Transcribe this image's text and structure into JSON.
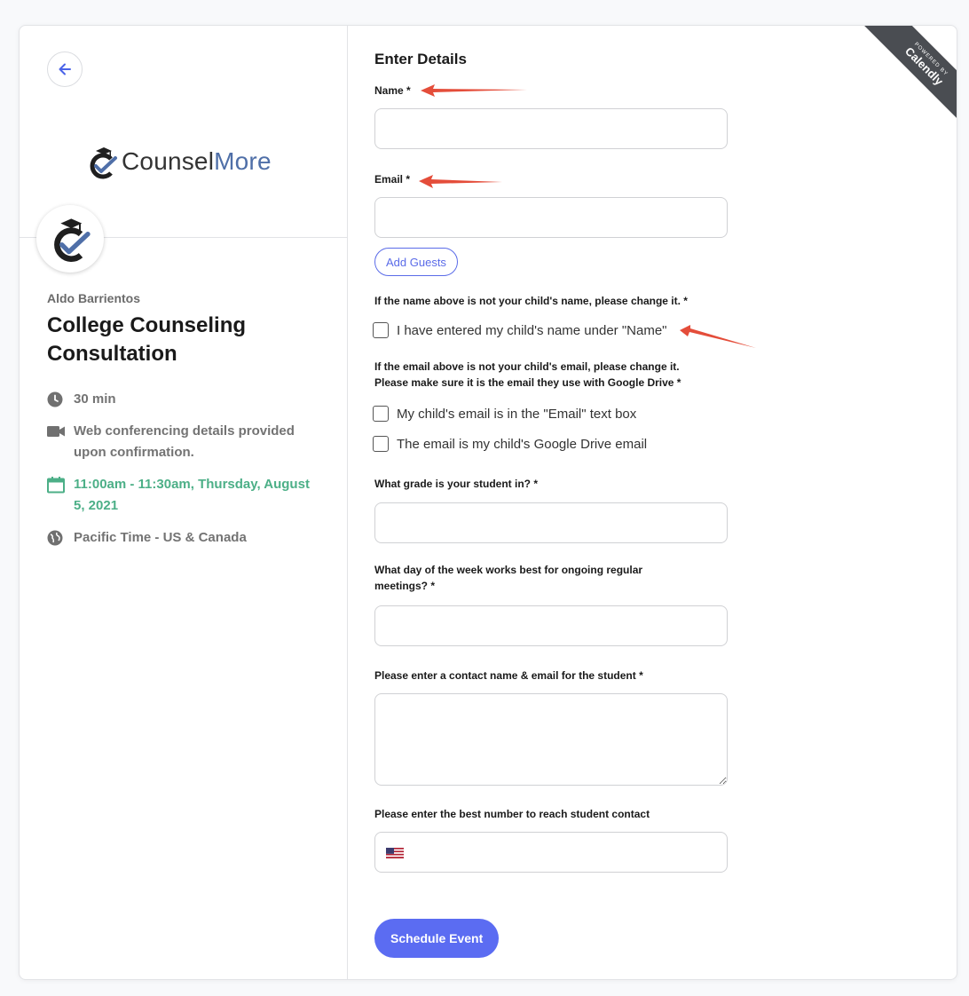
{
  "brand": {
    "part1": "Counsel",
    "part2": "More"
  },
  "sidebar": {
    "host": "Aldo Barrientos",
    "title": "College Counseling Consultation",
    "duration": "30 min",
    "conferencing": "Web conferencing details provided upon confirmation.",
    "datetime": "11:00am - 11:30am, Thursday, August 5, 2021",
    "timezone": "Pacific Time - US & Canada"
  },
  "form": {
    "heading": "Enter Details",
    "name_label": "Name *",
    "email_label": "Email *",
    "add_guests": "Add Guests",
    "child_name_label": "If the name above is not your child's name, please change it. *",
    "child_name_check": "I have entered my child's name under \"Name\"",
    "child_email_label_line1": "If the email above is not your child's email, please change it.",
    "child_email_label_line2": "Please make sure it is the email they use with Google Drive *",
    "child_email_check1": "My child's email is in the \"Email\" text box",
    "child_email_check2": "The email is my child's Google Drive email",
    "grade_label": "What grade is your student in? *",
    "day_label": "What day of the week works best for ongoing regular meetings? *",
    "contact_label": "Please enter a contact name & email for the student *",
    "phone_label": "Please enter the best number to reach student contact",
    "submit": "Schedule Event"
  },
  "badge": {
    "powered": "POWERED BY",
    "name": "Calendly"
  },
  "colors": {
    "accent": "#5b6cf2",
    "green": "#4caf87",
    "annotation": "#e44d3a"
  }
}
